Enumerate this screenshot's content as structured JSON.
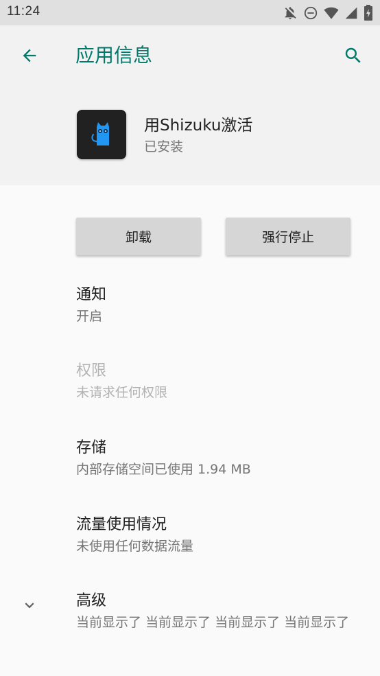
{
  "status_bar": {
    "time": "11:24",
    "icons": [
      "notifications-off-icon",
      "do-not-disturb-icon",
      "wifi-icon",
      "signal-icon",
      "battery-icon"
    ]
  },
  "toolbar": {
    "title": "应用信息",
    "back_icon": "arrow-back-icon",
    "search_icon": "search-icon",
    "accent_color": "#00796b"
  },
  "app": {
    "name": "用Shizuku激活",
    "status": "已安装",
    "icon": "shizuku-cat-icon",
    "icon_accent_color": "#2196f3"
  },
  "actions": {
    "uninstall_label": "卸载",
    "force_stop_label": "强行停止"
  },
  "preferences": [
    {
      "title": "通知",
      "summary": "开启",
      "enabled": true
    },
    {
      "title": "权限",
      "summary": "未请求任何权限",
      "enabled": false
    },
    {
      "title": "存储",
      "summary": "内部存储空间已使用 1.94 MB",
      "enabled": true
    },
    {
      "title": "流量使用情况",
      "summary": "未使用任何数据流量",
      "enabled": true
    },
    {
      "title": "高级",
      "summary": "当前显示了 当前显示了 当前显示了 当前显示了",
      "enabled": true,
      "icon": "chevron-down-icon"
    }
  ]
}
